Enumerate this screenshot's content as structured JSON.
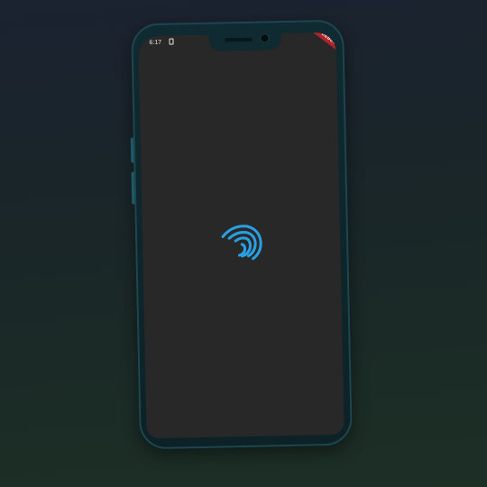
{
  "status_bar": {
    "time": "6:17",
    "sim_icon": "sim-card-icon",
    "wifi_icon": "wifi-icon",
    "debug_banner": "DEBUG"
  },
  "screen": {
    "background_color": "#282828",
    "loader_icon": "fingerprint-icon",
    "loader_color": "#2a9fe2"
  },
  "device": {
    "frame_color": "#0f2a30"
  }
}
